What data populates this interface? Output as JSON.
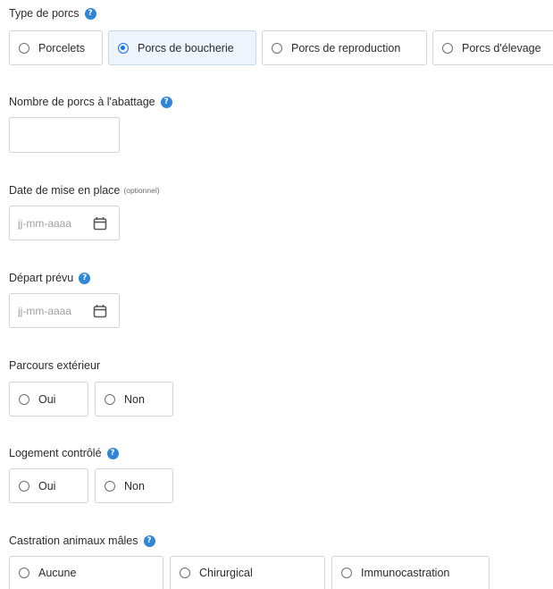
{
  "help_glyph": "?",
  "type_porcs": {
    "label": "Type de porcs",
    "options": [
      "Porcelets",
      "Porcs de boucherie",
      "Porcs de reproduction",
      "Porcs d'élevage"
    ],
    "selected": "Porcs de boucherie"
  },
  "nombre_porcs": {
    "label": "Nombre de porcs à l'abattage",
    "value": ""
  },
  "date_mise_en_place": {
    "label": "Date de mise en place",
    "optional": "(optionnel)",
    "placeholder": "jj-mm-aaaa",
    "icon": "calendar-icon"
  },
  "depart_prevu": {
    "label": "Départ prévu",
    "placeholder": "jj-mm-aaaa",
    "icon": "calendar-icon"
  },
  "parcours_exterieur": {
    "label": "Parcours extérieur",
    "options": [
      "Oui",
      "Non"
    ]
  },
  "logement_controle": {
    "label": "Logement contrôlé",
    "options": [
      "Oui",
      "Non"
    ]
  },
  "castration": {
    "label": "Castration animaux mâles",
    "options": [
      "Aucune",
      "Chirurgical",
      "Immunocastration"
    ]
  },
  "colors": {
    "accent": "#1a73e8",
    "help_icon": "#2f86d8",
    "selected_bg": "#eef4fb",
    "border": "#d4d4d4"
  }
}
